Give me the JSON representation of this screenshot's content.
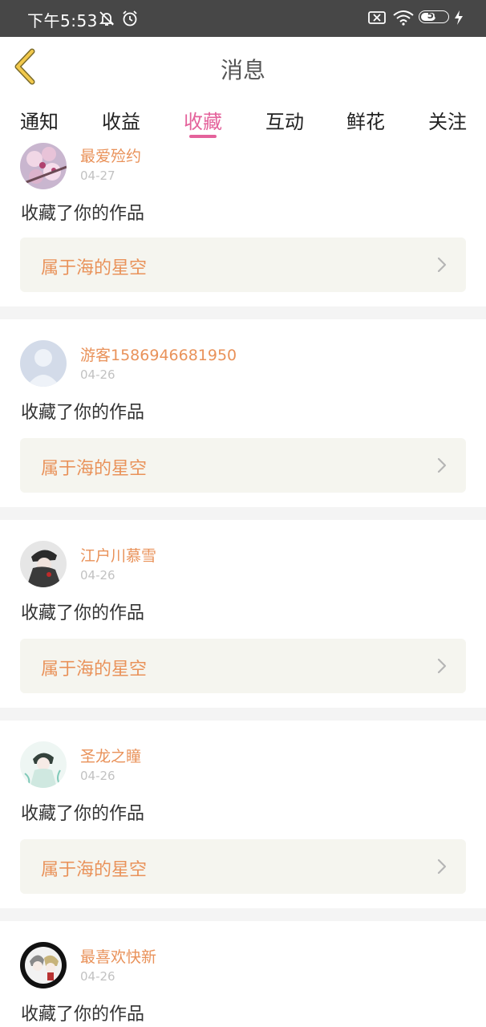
{
  "status_bar": {
    "time": "下午5:53",
    "battery": "50",
    "icons": [
      "mute-icon",
      "alarm-icon",
      "sim-x-icon",
      "wifi-icon",
      "battery-icon",
      "charging-icon"
    ]
  },
  "nav": {
    "title": "消息",
    "back_icon": "chevron-left-icon"
  },
  "tabs": [
    {
      "label": "通知"
    },
    {
      "label": "收益"
    },
    {
      "label": "收藏",
      "active": true
    },
    {
      "label": "互动"
    },
    {
      "label": "鲜花"
    },
    {
      "label": "关注"
    }
  ],
  "items": [
    {
      "username": "最爱殓约",
      "date": "04-27",
      "action": "收藏了你的作品",
      "work_title": "属于海的星空",
      "avatar": "cherry-blossom"
    },
    {
      "username": "游客1586946681950",
      "date": "04-26",
      "action": "收藏了你的作品",
      "work_title": "属于海的星空",
      "avatar": "default-user"
    },
    {
      "username": "江户川慕雪",
      "date": "04-26",
      "action": "收藏了你的作品",
      "work_title": "属于海的星空",
      "avatar": "anime-dark"
    },
    {
      "username": "圣龙之瞳",
      "date": "04-26",
      "action": "收藏了你的作品",
      "work_title": "属于海的星空",
      "avatar": "anime-light"
    },
    {
      "username": "最喜欢快新",
      "date": "04-26",
      "action": "收藏了你的作品",
      "work_title": "",
      "avatar": "anime-duo"
    }
  ],
  "colors": {
    "accent": "#e4629b",
    "name": "#e9925a",
    "work_bg": "#f5f5ef",
    "status_bar": "#474747"
  }
}
